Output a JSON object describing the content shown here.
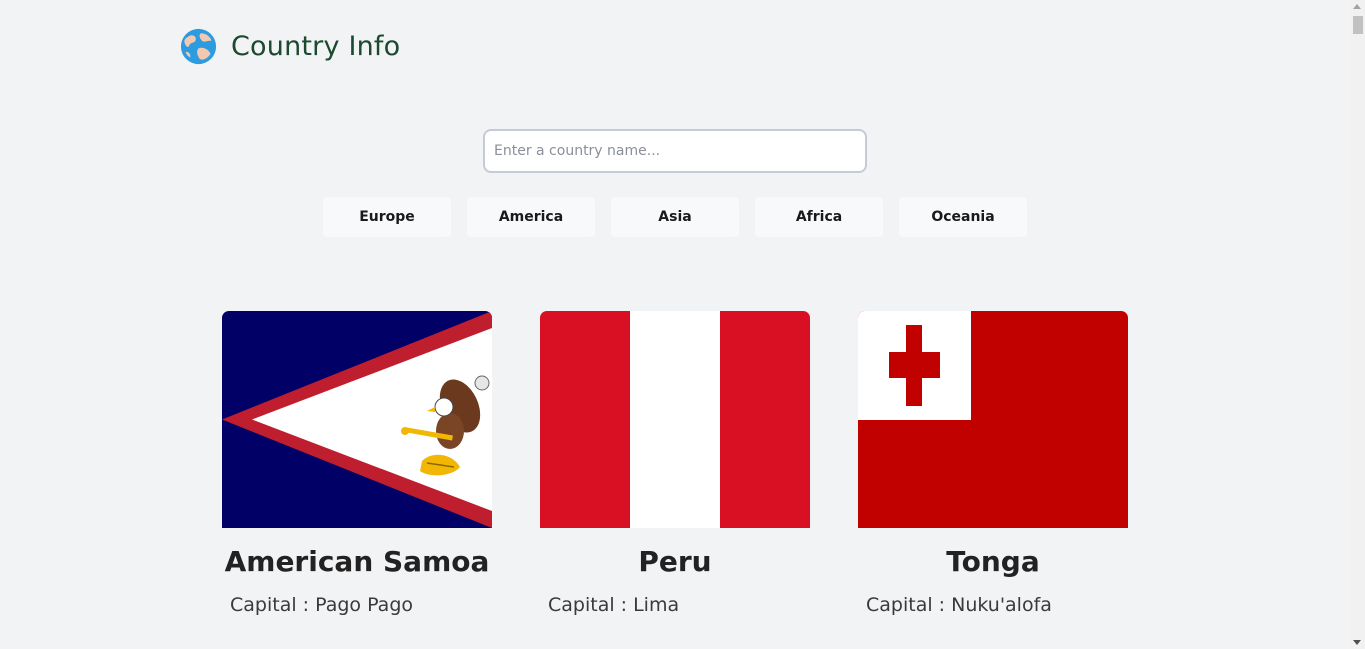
{
  "header": {
    "title": "Country Info",
    "logo_icon": "globe-icon"
  },
  "search": {
    "placeholder": "Enter a country name...",
    "value": ""
  },
  "filters": [
    {
      "label": "Europe"
    },
    {
      "label": "America"
    },
    {
      "label": "Asia"
    },
    {
      "label": "Africa"
    },
    {
      "label": "Oceania"
    }
  ],
  "countries": [
    {
      "name": "American Samoa",
      "capital": "Capital : Pago Pago",
      "flag": "american-samoa-flag"
    },
    {
      "name": "Peru",
      "capital": "Capital : Lima",
      "flag": "peru-flag"
    },
    {
      "name": "Tonga",
      "capital": "Capital : Nuku'alofa",
      "flag": "tonga-flag"
    }
  ],
  "colors": {
    "background": "#f2f3f5",
    "title": "#1c4a2e",
    "peru_red": "#d91023",
    "tonga_red": "#c10000",
    "samoa_blue": "#000066",
    "samoa_red": "#bf1e2e"
  }
}
